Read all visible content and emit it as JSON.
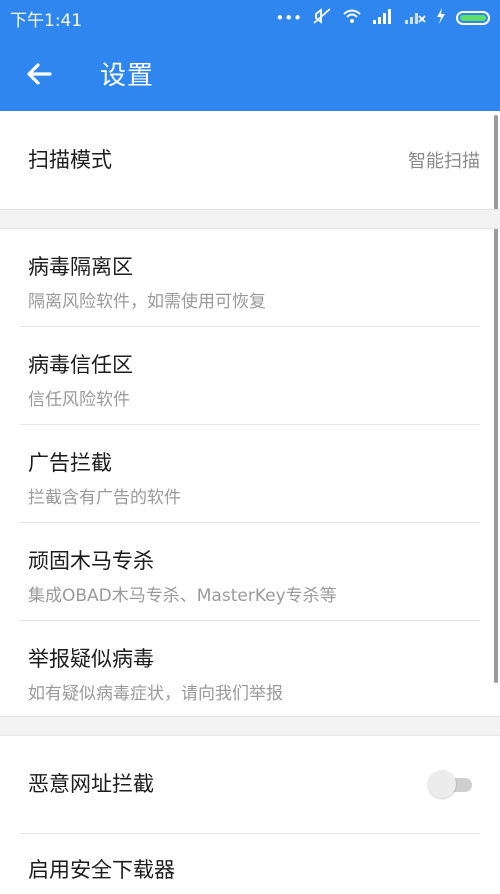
{
  "status_bar": {
    "time": "下午1:41"
  },
  "toolbar": {
    "back_icon": "arrow-left-icon",
    "title": "设置"
  },
  "settings": {
    "scan_mode": {
      "label": "扫描模式",
      "value": "智能扫描"
    },
    "items": [
      {
        "title": "病毒隔离区",
        "subtitle": "隔离风险软件，如需使用可恢复"
      },
      {
        "title": "病毒信任区",
        "subtitle": "信任风险软件"
      },
      {
        "title": "广告拦截",
        "subtitle": "拦截含有广告的软件"
      },
      {
        "title": "顽固木马专杀",
        "subtitle": "集成OBAD木马专杀、MasterKey专杀等"
      },
      {
        "title": "举报疑似病毒",
        "subtitle": "如有疑似病毒症状，请向我们举报"
      }
    ],
    "malicious_url": {
      "title": "恶意网址拦截",
      "enabled": false
    },
    "secure_downloader": {
      "title": "启用安全下载器"
    }
  },
  "colors": {
    "appbar": "#2f86ee",
    "text_primary": "#1d1d1d",
    "text_secondary": "#9a9a9a"
  }
}
